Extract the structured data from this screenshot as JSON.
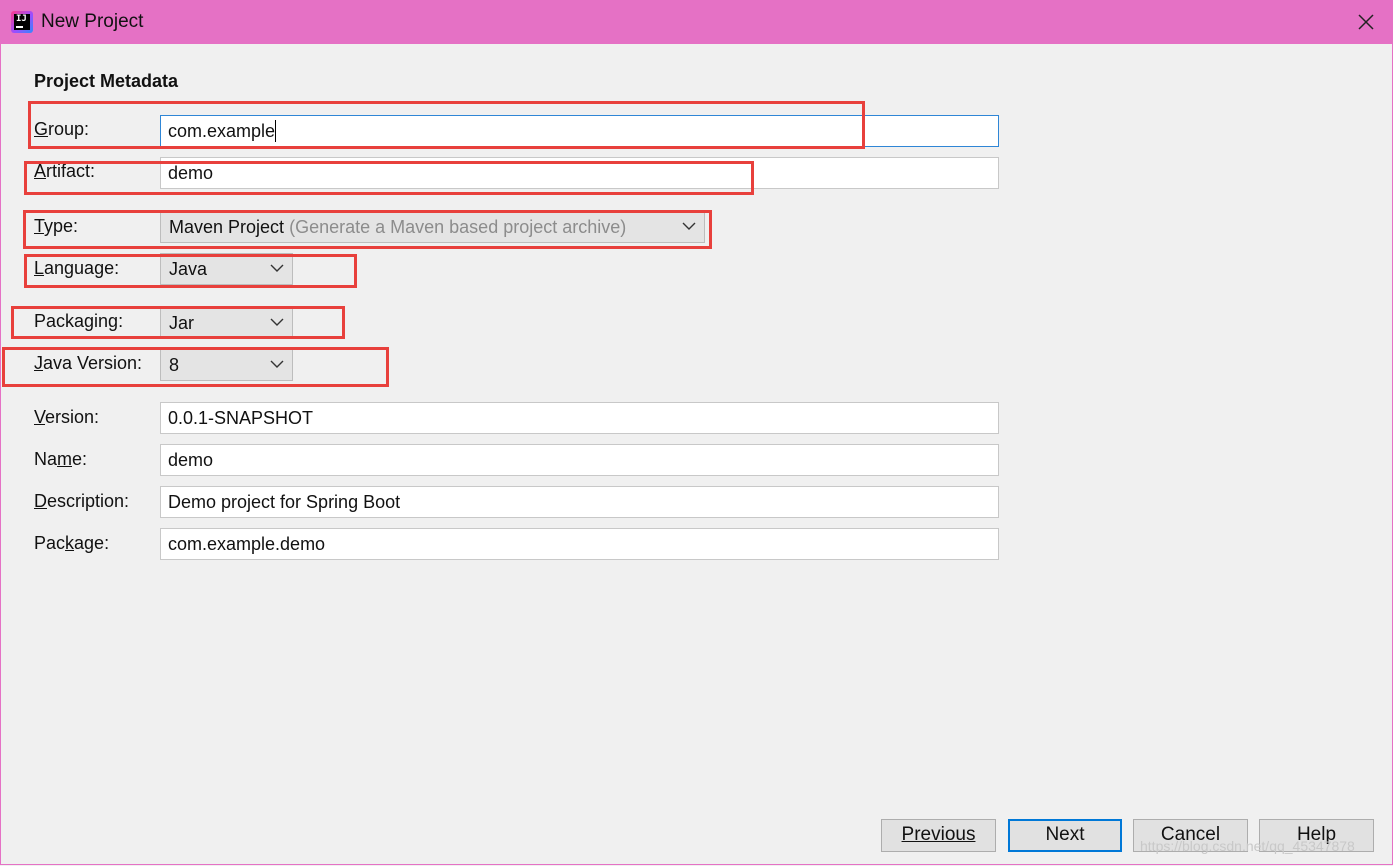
{
  "window": {
    "title": "New Project",
    "accent_color": "#e571c5"
  },
  "section_title": "Project Metadata",
  "fields": {
    "group": {
      "label": "Group:",
      "value": "com.example"
    },
    "artifact": {
      "label": "Artifact:",
      "value": "demo"
    },
    "type": {
      "label": "Type:",
      "value": "Maven Project",
      "hint": "(Generate a Maven based project archive)"
    },
    "language": {
      "label": "Language:",
      "value": "Java"
    },
    "packaging": {
      "label": "Packaging:",
      "value": "Jar"
    },
    "java_version": {
      "label": "Java Version:",
      "value": "8"
    },
    "version": {
      "label": "Version:",
      "value": "0.0.1-SNAPSHOT"
    },
    "name": {
      "label": "Name:",
      "value": "demo"
    },
    "description": {
      "label": "Description:",
      "value": "Demo project for Spring Boot"
    },
    "package": {
      "label": "Package:",
      "value": "com.example.demo"
    }
  },
  "buttons": {
    "previous": "Previous",
    "next": "Next",
    "cancel": "Cancel",
    "help": "Help"
  },
  "annotation_color": "#e8403c",
  "watermark": "https://blog.csdn.net/qq_45347878"
}
